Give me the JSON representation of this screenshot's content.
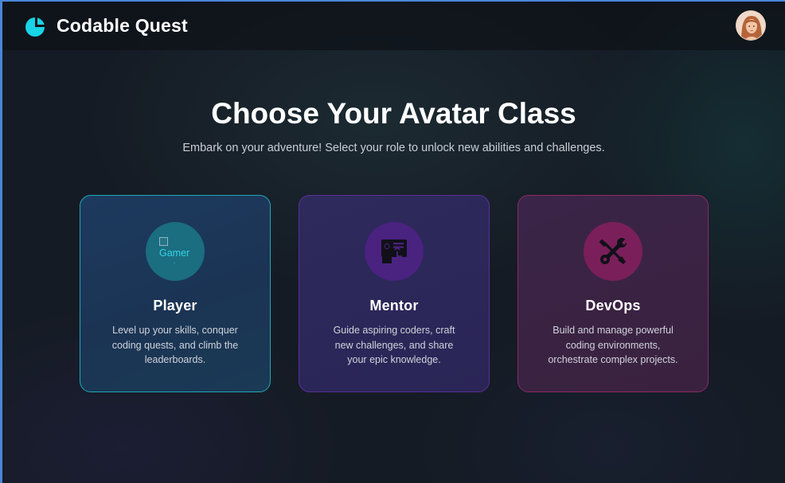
{
  "header": {
    "brand": "Codable Quest",
    "logo_icon": "codable-logo-icon",
    "avatar_icon": "user-avatar",
    "accent_color": "#19d3e6"
  },
  "hero": {
    "title": "Choose Your Avatar Class",
    "subtitle": "Embark on your adventure! Select your role to unlock new abilities and challenges."
  },
  "cards": [
    {
      "title": "Player",
      "description": "Level up your skills, conquer coding quests, and climb the leaderboards.",
      "icon": "gamer-image-broken",
      "icon_alt": "Gamer",
      "border_color": "#1fa8b8"
    },
    {
      "title": "Mentor",
      "description": "Guide aspiring coders, craft new challenges, and share your epic knowledge.",
      "icon": "teacher-board-icon",
      "border_color": "#5a2f98"
    },
    {
      "title": "DevOps",
      "description": "Build and manage powerful coding environments, orchestrate complex projects.",
      "icon": "wrench-screwdriver-icon",
      "border_color": "#8c2a64"
    }
  ]
}
